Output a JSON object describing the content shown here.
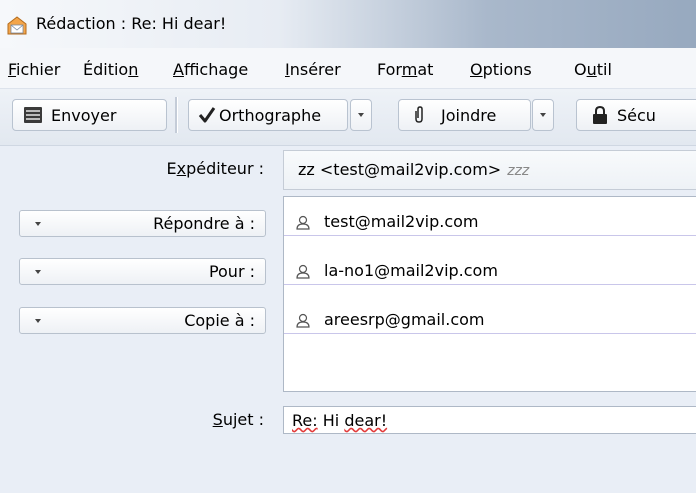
{
  "window": {
    "title": "Rédaction : Re: Hi dear!",
    "icon": "compose-window-icon"
  },
  "menu": [
    {
      "pre": "",
      "u": "F",
      "post": "ichier"
    },
    {
      "pre": "Éditio",
      "u": "n",
      "post": ""
    },
    {
      "pre": "",
      "u": "A",
      "post": "ffichage"
    },
    {
      "pre": "",
      "u": "I",
      "post": "nsérer"
    },
    {
      "pre": "For",
      "u": "m",
      "post": "at"
    },
    {
      "pre": "",
      "u": "O",
      "post": "ptions"
    },
    {
      "pre": "O",
      "u": "u",
      "post": "til"
    }
  ],
  "toolbar": {
    "send_label": "Envoyer",
    "spell_label": "Orthographe",
    "attach_label": "Joindre",
    "security_label": "Sécu"
  },
  "headers": {
    "sender_label_pre": "E",
    "sender_label_u": "x",
    "sender_label_post": "péditeur :",
    "sender_value": "zz <test@mail2vip.com>",
    "sender_sub": "zzz",
    "recipients": [
      {
        "type": "Répondre à :",
        "address": "test@mail2vip.com"
      },
      {
        "type": "Pour :",
        "address": "la-no1@mail2vip.com"
      },
      {
        "type": "Copie à :",
        "address": "areesrp@gmail.com"
      }
    ],
    "subject_label_u": "S",
    "subject_label_post": "ujet :",
    "subject_re": "Re:",
    "subject_hi": "Hi",
    "subject_dear": "dear!"
  }
}
